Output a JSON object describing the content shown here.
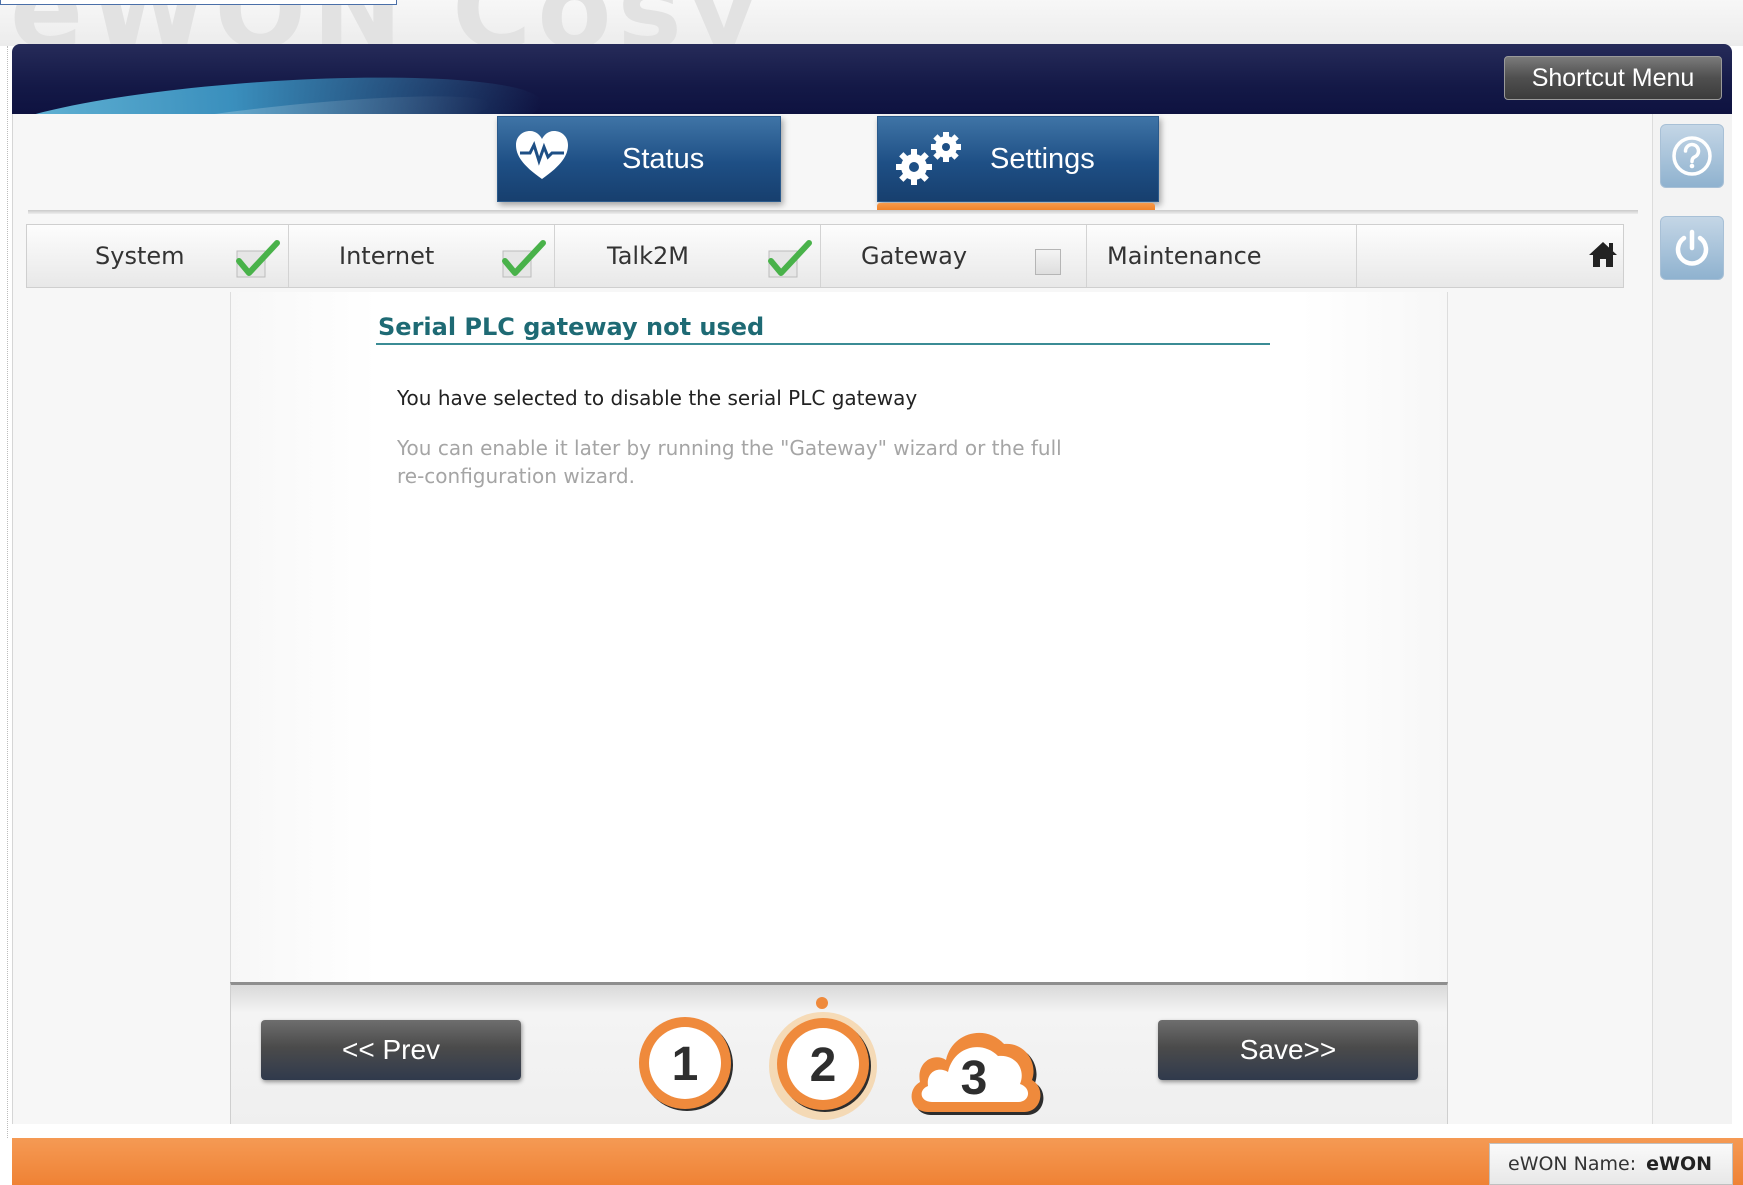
{
  "logo": {
    "text": "eWON Cosy"
  },
  "header": {
    "shortcut_menu_label": "Shortcut Menu"
  },
  "main_tabs": [
    {
      "label": "Status",
      "icon": "heart-pulse-icon",
      "active": false
    },
    {
      "label": "Settings",
      "icon": "gears-icon",
      "active": true
    }
  ],
  "right_rail": {
    "help_icon": "help-icon",
    "power_icon": "power-icon"
  },
  "wizard_steps": [
    {
      "label": "System",
      "status": "checked"
    },
    {
      "label": "Internet",
      "status": "checked"
    },
    {
      "label": "Talk2M",
      "status": "checked"
    },
    {
      "label": "Gateway",
      "status": "unchecked"
    },
    {
      "label": "Maintenance",
      "status": "none"
    }
  ],
  "home_icon": "home-icon",
  "content": {
    "title": "Serial PLC gateway not used",
    "message": "You have selected to disable the serial PLC gateway",
    "hint": "You can enable it later by running the \"Gateway\" wizard or the full re-configuration wizard."
  },
  "footer": {
    "prev_label": "<< Prev",
    "save_label": "Save>>",
    "steps": [
      "1",
      "2",
      "3"
    ],
    "current_step": 2
  },
  "status_bar": {
    "ewon_name_label": "eWON Name:",
    "ewon_name_value": "eWON"
  },
  "colors": {
    "header_navy": "#141947",
    "tab_blue": "#1e4f85",
    "accent_orange": "#ef7b1f",
    "title_teal": "#1e6a74"
  }
}
